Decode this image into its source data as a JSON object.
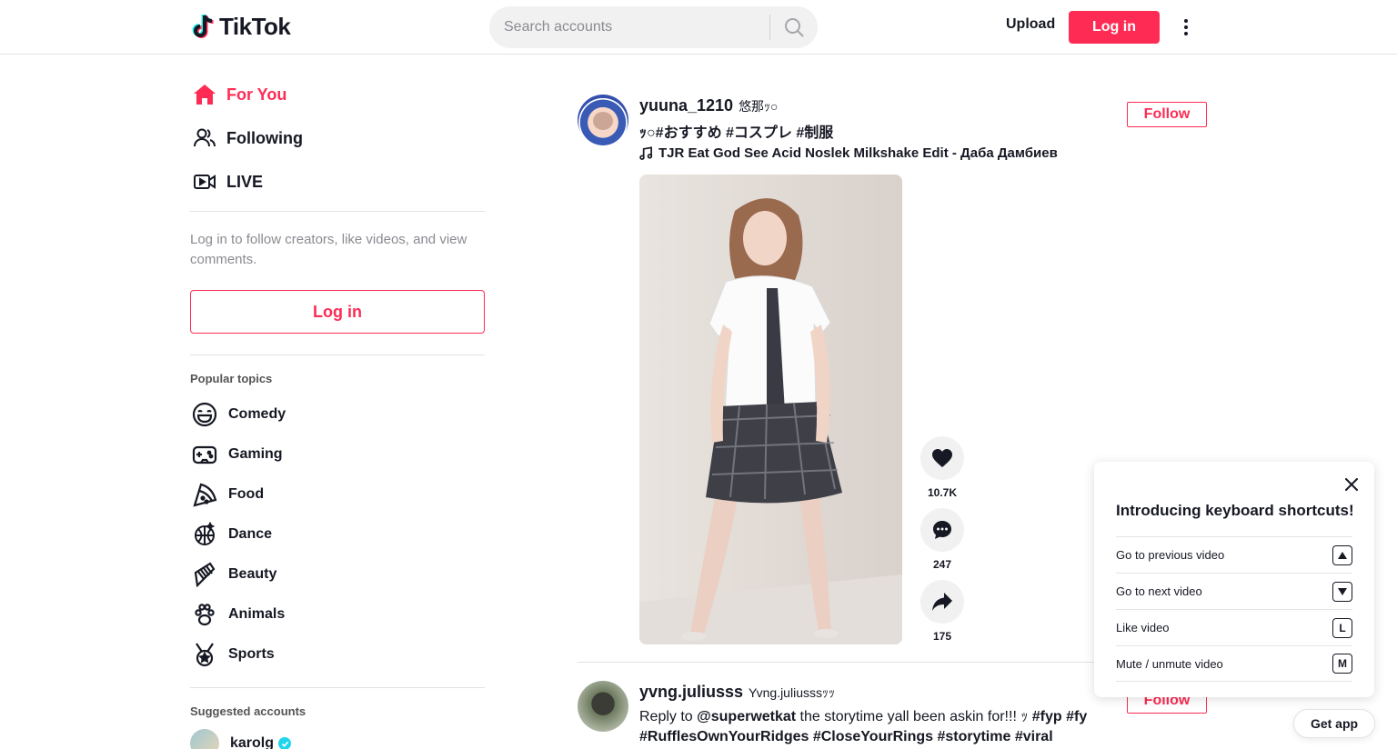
{
  "header": {
    "logo_text": "TikTok",
    "search_placeholder": "Search accounts",
    "upload_label": "Upload",
    "login_label": "Log in"
  },
  "sidebar": {
    "nav": [
      {
        "label": "For You",
        "icon": "home-icon"
      },
      {
        "label": "Following",
        "icon": "users-icon"
      },
      {
        "label": "LIVE",
        "icon": "live-icon"
      }
    ],
    "login_prompt": "Log in to follow creators, like videos, and view comments.",
    "login_button": "Log in",
    "topics_title": "Popular topics",
    "topics": [
      {
        "label": "Comedy",
        "icon": "smile-icon"
      },
      {
        "label": "Gaming",
        "icon": "gamepad-icon"
      },
      {
        "label": "Food",
        "icon": "pizza-icon"
      },
      {
        "label": "Dance",
        "icon": "disco-ball-icon"
      },
      {
        "label": "Beauty",
        "icon": "comb-icon"
      },
      {
        "label": "Animals",
        "icon": "paw-icon"
      },
      {
        "label": "Sports",
        "icon": "medal-icon"
      }
    ],
    "suggested_title": "Suggested accounts",
    "suggested": [
      {
        "name": "karolg",
        "verified": true
      }
    ]
  },
  "feed": {
    "posts": [
      {
        "author": "yuuna_1210",
        "nickname": "悠那ｯ○",
        "caption": "ｯ○#おすすめ #コスプレ #制服",
        "music": "TJR Eat God See Acid Noslek Milkshake Edit - Даба Дамбиев",
        "follow_label": "Follow",
        "likes": "10.7K",
        "comments": "247",
        "shares": "175"
      },
      {
        "author": "yvng.juliusss",
        "nickname": "Yvng.juliusssｯｯ",
        "caption_prefix": "Reply to ",
        "mention": "@superwetkat",
        "caption_text": " the storytime yall been askin for!!! ｯ ",
        "hashtags_line1": "#fyp #fy",
        "hashtags_line2": "#RufflesOwnYourRidges #CloseYourRings #storytime #viral",
        "follow_label": "Follow"
      }
    ]
  },
  "shortcuts": {
    "title": "Introducing keyboard shortcuts!",
    "items": [
      {
        "label": "Go to previous video",
        "key": "▲"
      },
      {
        "label": "Go to next video",
        "key": "▼"
      },
      {
        "label": "Like video",
        "key": "L"
      },
      {
        "label": "Mute / unmute video",
        "key": "M"
      }
    ]
  },
  "get_app_label": "Get app",
  "colors": {
    "brand": "#fe2c55",
    "text": "#161823",
    "muted": "#8a8b91"
  }
}
